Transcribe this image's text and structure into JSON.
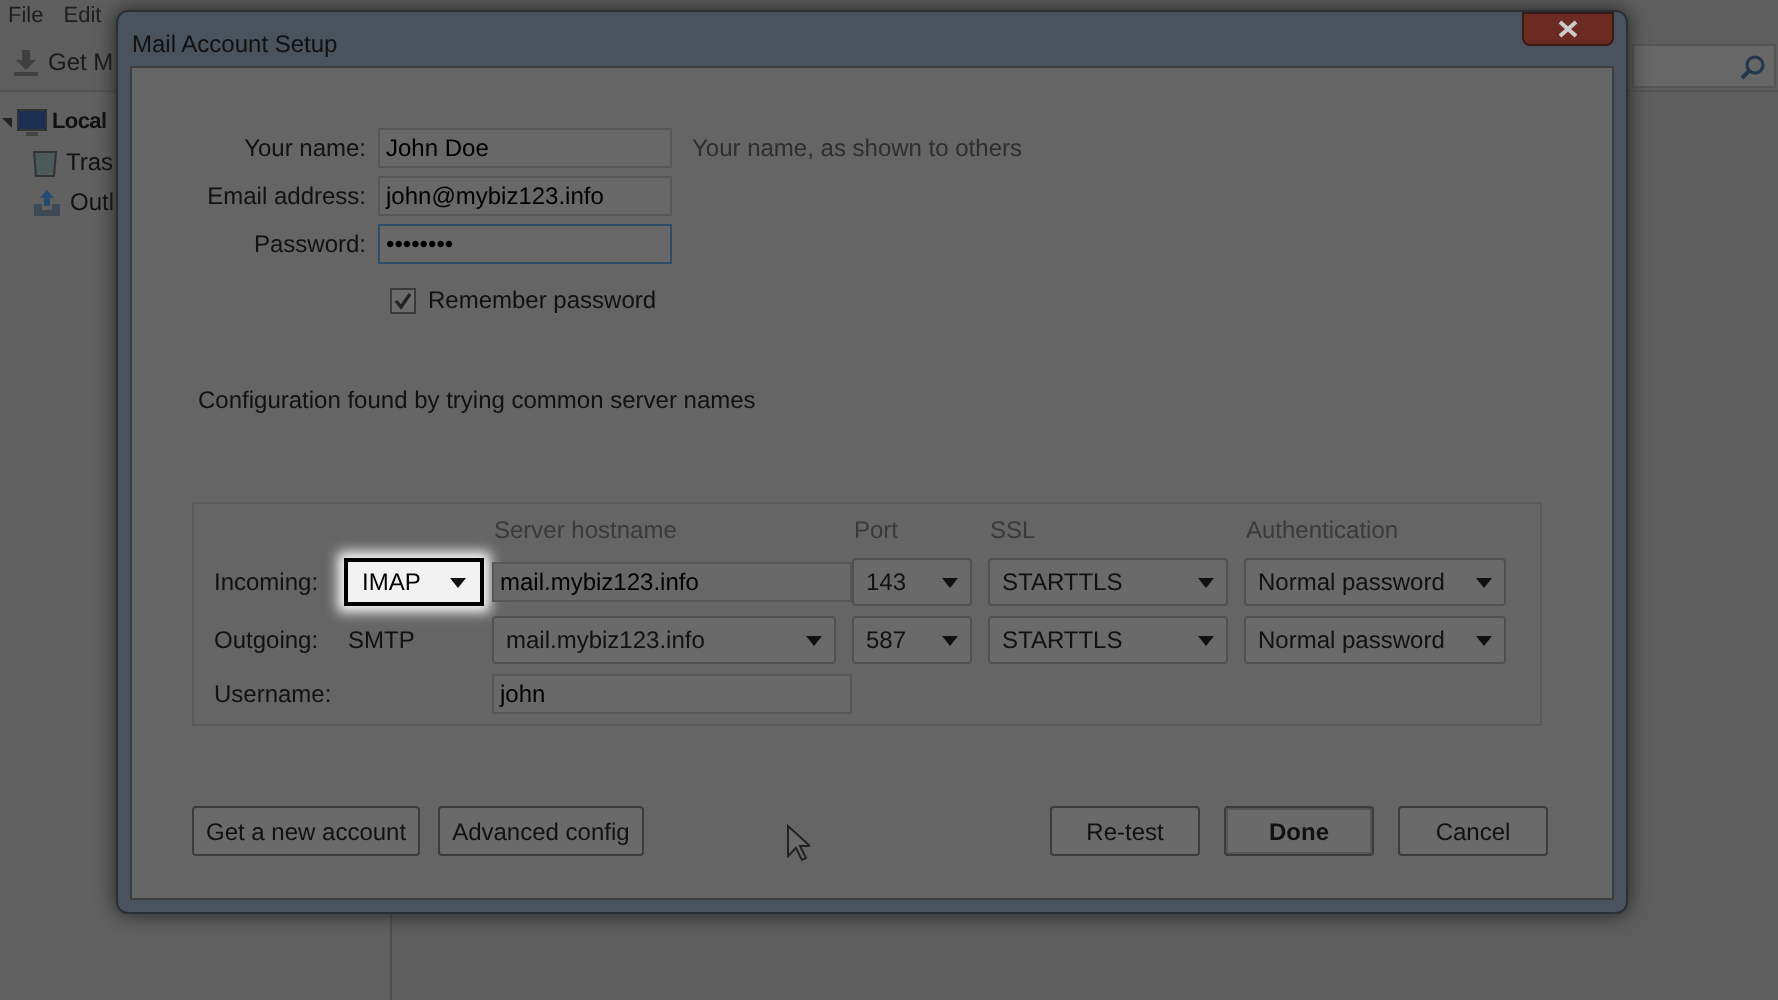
{
  "app": {
    "menu": [
      "File",
      "Edit"
    ],
    "toolbar": {
      "get_messages": "Get M"
    },
    "folders": [
      {
        "label": "Local",
        "expanded": true,
        "children": [
          {
            "label": "Tras"
          },
          {
            "label": "Outl"
          }
        ]
      }
    ]
  },
  "dialog": {
    "title": "Mail Account Setup",
    "fields": [
      {
        "label": "Your name:",
        "value": "John Doe",
        "focused": false
      },
      {
        "label": "Email address:",
        "value": "john@mybiz123.info",
        "focused": false
      },
      {
        "label": "Password:",
        "value": "••••••••",
        "focused": true
      }
    ],
    "hint": "Your name, as shown to others",
    "remember": {
      "label": "Remember password",
      "checked": true
    },
    "status": "Configuration found by trying common server names",
    "server": {
      "columns": [
        "",
        "Server hostname",
        "Port",
        "SSL",
        "Authentication"
      ],
      "rows": [
        {
          "label": "Incoming:",
          "cells": [
            {
              "kind": "select",
              "value": "IMAP",
              "highlighted": true
            },
            {
              "kind": "input",
              "value": "mail.mybiz123.info"
            },
            {
              "kind": "select",
              "value": "143"
            },
            {
              "kind": "select",
              "value": "STARTTLS"
            },
            {
              "kind": "select",
              "value": "Normal password"
            }
          ]
        },
        {
          "label": "Outgoing:",
          "cells": [
            {
              "kind": "text",
              "value": "SMTP"
            },
            {
              "kind": "select",
              "value": "mail.mybiz123.info"
            },
            {
              "kind": "select",
              "value": "587"
            },
            {
              "kind": "select",
              "value": "STARTTLS"
            },
            {
              "kind": "select",
              "value": "Normal password"
            }
          ]
        },
        {
          "label": "Username:",
          "cells": [
            {
              "kind": "blank"
            },
            {
              "kind": "input",
              "value": "john"
            }
          ]
        }
      ]
    },
    "buttons_left": [
      {
        "label": "Get a new account",
        "default": false
      },
      {
        "label": "Advanced config",
        "default": false
      }
    ],
    "buttons_right": [
      {
        "label": "Re-test",
        "default": false
      },
      {
        "label": "Done",
        "default": true
      },
      {
        "label": "Cancel",
        "default": false
      }
    ]
  }
}
